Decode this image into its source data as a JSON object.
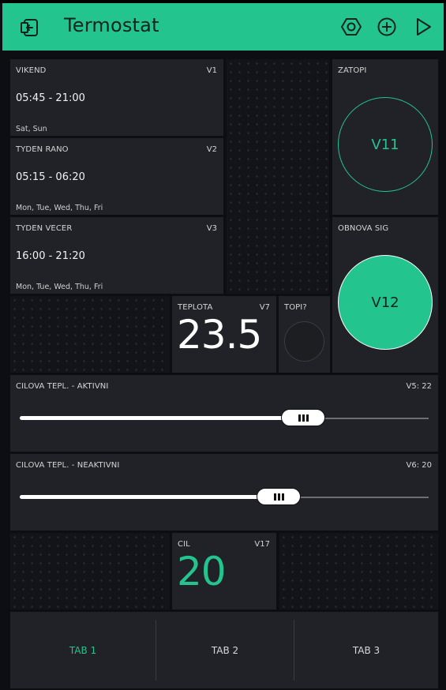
{
  "app": {
    "title": "Termostat"
  },
  "toolbar": {
    "exit_icon": "exit-icon",
    "settings_icon": "hexagon-nut-icon",
    "add_icon": "add-circle-icon",
    "play_icon": "play-icon"
  },
  "timers": [
    {
      "label": "VIKEND",
      "pin": "V1",
      "time": "05:45 - 21:00",
      "days": "Sat, Sun"
    },
    {
      "label": "TYDEN RANO",
      "pin": "V2",
      "time": "05:15 - 06:20",
      "days": "Mon, Tue, Wed, Thu, Fri"
    },
    {
      "label": "TYDEN VECER",
      "pin": "V3",
      "time": "16:00 - 21:20",
      "days": "Mon, Tue, Wed, Thu, Fri"
    }
  ],
  "buttons": [
    {
      "label": "ZATOPI",
      "value": "V11",
      "state": "off"
    },
    {
      "label": "OBNOVA SIG",
      "value": "V12",
      "state": "on"
    }
  ],
  "teplota": {
    "label": "TEPLOTA",
    "pin": "V7",
    "value": "23.5"
  },
  "led": {
    "label": "TOPI?"
  },
  "sliders": [
    {
      "label": "CILOVA TEPL. - AKTIVNI",
      "pin": "V5: 22"
    },
    {
      "label": "CILOVA TEPL. - NEAKTIVNI",
      "pin": "V6: 20"
    }
  ],
  "cil": {
    "label": "CIL",
    "pin": "V17",
    "value": "20"
  },
  "tabs": [
    {
      "label": "TAB 1",
      "active": true
    },
    {
      "label": "TAB 2",
      "active": false
    },
    {
      "label": "TAB 3",
      "active": false
    }
  ],
  "colors": {
    "accent": "#23c48e",
    "widget": "#212227",
    "background": "#0d0e12"
  }
}
